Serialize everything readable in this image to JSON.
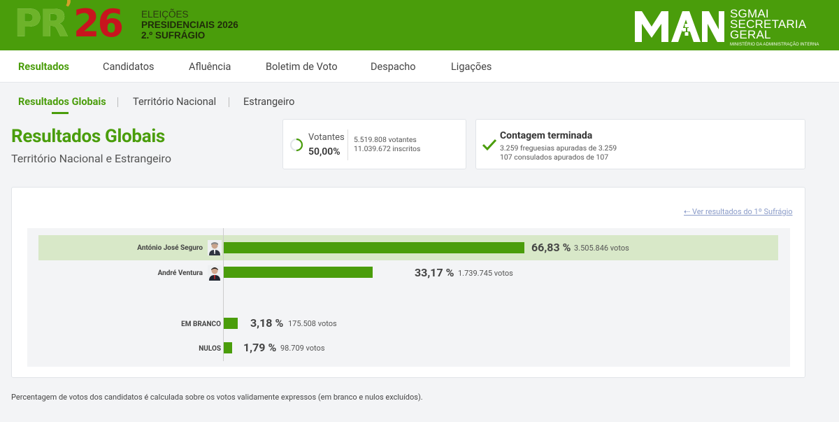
{
  "header": {
    "logo_pr": "PR",
    "logo_num": "26",
    "line1": "ELEIÇÕES",
    "line2": "PRESIDENCIAIS 2026",
    "line3": "2.º SUFRÁGIO",
    "org_line1": "SGMAI",
    "org_line2": "SECRETARIA",
    "org_line3": "GERAL",
    "org_line4": "MINISTÉRIO DA ADMINISTRAÇÃO INTERNA"
  },
  "nav": {
    "items": [
      "Resultados",
      "Candidatos",
      "Afluência",
      "Boletim de Voto",
      "Despacho",
      "Ligações"
    ]
  },
  "subnav": {
    "items": [
      "Resultados Globais",
      "Território Nacional",
      "Estrangeiro"
    ]
  },
  "page": {
    "title": "Resultados Globais",
    "subtitle": "Território Nacional e Estrangeiro"
  },
  "votantes": {
    "label": "Votantes",
    "pct": "50,00%",
    "votantes": "5.519.808 votantes",
    "inscritos": "11.039.672 inscritos"
  },
  "contagem": {
    "title": "Contagem terminada",
    "freguesias": "3.259 freguesias apuradas de 3.259",
    "consulados": "107 consulados apurados de 107"
  },
  "results": {
    "link": "Ver resultados do 1º Sufrágio",
    "rows": [
      {
        "name": "António José Seguro",
        "pct": "66,83 %",
        "pct_value": 66.83,
        "votes": "3.505.846 votos"
      },
      {
        "name": "André Ventura",
        "pct": "33,17 %",
        "pct_value": 33.17,
        "votes": "1.739.745 votos"
      },
      {
        "name": "EM BRANCO",
        "pct": "3,18 %",
        "pct_value": 3.18,
        "votes": "175.508 votos"
      },
      {
        "name": "NULOS",
        "pct": "1,79 %",
        "pct_value": 1.79,
        "votes": "98.709 votos"
      }
    ]
  },
  "footnote": "Percentagem de votos dos candidatos é calculada sobre os votos validamente expressos (em branco e nulos excluídos).",
  "colors": {
    "brand_green": "#4a9d0b",
    "highlight": "#d8e8c8",
    "pr_red": "#c8141e"
  }
}
